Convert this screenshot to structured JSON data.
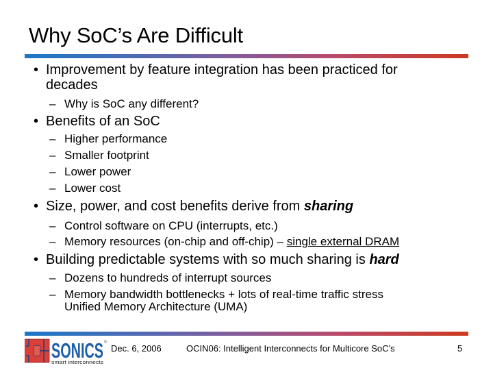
{
  "slide": {
    "title": "Why SoC’s Are Difficult",
    "accent_gradient": [
      "#1a78c6",
      "#8a5a96",
      "#cc3a20"
    ],
    "bullets": [
      {
        "text_lines": [
          "Improvement by feature integration has been practiced for",
          "decades"
        ],
        "subitems": [
          "Why is SoC any different?"
        ]
      },
      {
        "text": "Benefits of an SoC",
        "subitems": [
          "Higher performance",
          "Smaller footprint",
          "Lower power",
          "Lower cost"
        ]
      },
      {
        "text_prefix": "Size, power, and cost benefits derive from ",
        "text_emphasis": "sharing",
        "subitems": [
          {
            "text": "Control software on CPU (interrupts, etc.)"
          },
          {
            "text_prefix": "Memory resources (on-chip and off-chip) – ",
            "text_underlined": "single external DRAM"
          }
        ]
      },
      {
        "text_prefix": "Building predictable systems with so much sharing is ",
        "text_emphasis": "hard",
        "subitems": [
          {
            "text": "Dozens to hundreds of interrupt sources"
          },
          {
            "text_lines": [
              "Memory bandwidth bottlenecks + lots of real-time traffic stress",
              "Unified Memory Architecture (UMA)"
            ]
          }
        ]
      }
    ],
    "bullet_glyph": "•",
    "dash_glyph": "–"
  },
  "footer": {
    "logo": {
      "name": "SONICS",
      "tagline": "smart interconnects",
      "registered": "®",
      "text_color": "#1f5ea8",
      "mark_color": "#d9403a"
    },
    "date": "Dec. 6, 2006",
    "conference": "OCIN06: Intelligent Interconnects for Multicore SoC’s",
    "page_number": "5"
  }
}
